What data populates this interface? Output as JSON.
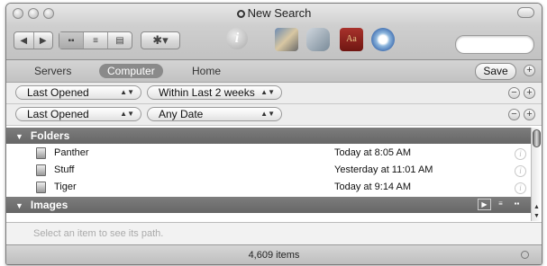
{
  "window": {
    "title": "New Search"
  },
  "toolbar": {
    "icons": [
      "back-icon",
      "forward-icon",
      "icon-view-icon",
      "list-view-icon",
      "column-view-icon",
      "action-gear-icon",
      "info-icon",
      "image-capture-app-icon",
      "preview-app-icon",
      "dictionary-app-icon",
      "safari-app-icon"
    ],
    "search_placeholder": ""
  },
  "scope": {
    "items": [
      {
        "label": "Servers"
      },
      {
        "label": "Computer",
        "selected": true
      },
      {
        "label": "Home"
      }
    ],
    "save_label": "Save"
  },
  "criteria": [
    {
      "attribute": "Last Opened",
      "value": "Within Last 2 weeks"
    },
    {
      "attribute": "Last Opened",
      "value": "Any Date"
    }
  ],
  "results": {
    "groups": [
      {
        "title": "Folders",
        "expanded": true,
        "rows": [
          {
            "name": "Panther",
            "date": "Today at 8:05 AM"
          },
          {
            "name": "Stuff",
            "date": "Yesterday at 11:01 AM"
          },
          {
            "name": "Tiger",
            "date": "Today at 9:14 AM"
          }
        ]
      },
      {
        "title": "Images",
        "expanded": false,
        "rows": []
      }
    ]
  },
  "path_bar": {
    "placeholder": "Select an item to see its path."
  },
  "status": {
    "items_count": "4,609 items"
  },
  "colors": {
    "group_header": "#6e6e6e",
    "scope_selected": "#8a8a8a"
  }
}
